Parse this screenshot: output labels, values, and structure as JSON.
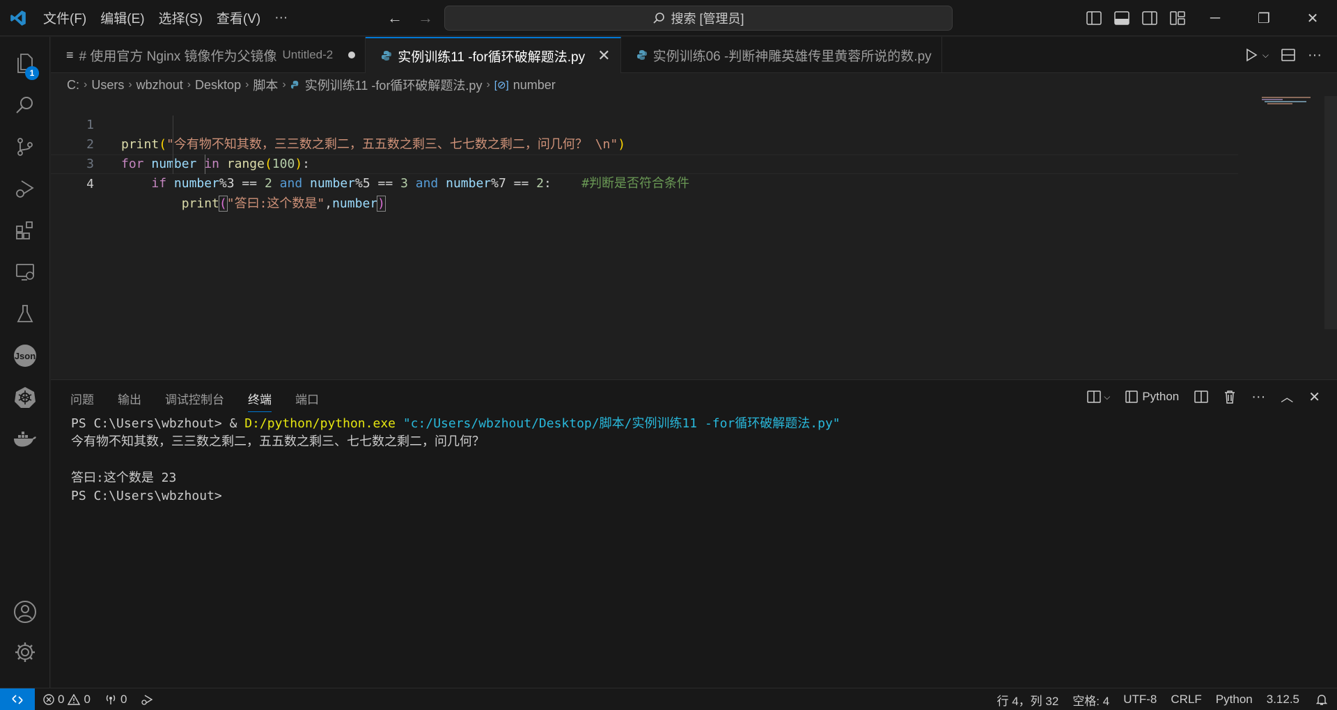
{
  "menu": {
    "file": "文件(F)",
    "edit": "编辑(E)",
    "selection": "选择(S)",
    "view": "查看(V)",
    "more": "···"
  },
  "search": {
    "label": "搜索 [管理员]"
  },
  "activity": {
    "badge_count": "1",
    "json_label": "Json"
  },
  "tabs": [
    {
      "label": "# 使用官方 Nginx 镜像作为父镜像",
      "hint": "Untitled-2"
    },
    {
      "label": "实例训练11 -for循环破解题法.py"
    },
    {
      "label": "实例训练06 -判断神雕英雄传里黄蓉所说的数.py"
    }
  ],
  "breadcrumb": {
    "drive": "C:",
    "users": "Users",
    "user": "wbzhout",
    "desktop": "Desktop",
    "folder": "脚本",
    "file": "实例训练11 -for循环破解题法.py",
    "symbol": "number"
  },
  "code": {
    "line_numbers": [
      "1",
      "2",
      "3",
      "4"
    ],
    "l1": {
      "fn": "print",
      "open": "(",
      "str": "\"今有物不知其数，三三数之剩二，五五数之剩三、七七数之剩二，问几何？ \\n\"",
      "close": ")"
    },
    "l2": {
      "for": "for",
      "var": "number",
      "in": "in",
      "fn": "range",
      "open": "(",
      "num": "100",
      "close": ")",
      "colon": ":"
    },
    "l3": {
      "if": "if",
      "v1": "number",
      "m1": "%3 == ",
      "n1": "2",
      "and1": "and",
      "v2": "number",
      "m2": "%5 == ",
      "n2": "3",
      "and2": "and",
      "v3": "number",
      "m3": "%7 == ",
      "n3": "2",
      "colon": ":",
      "comment": "#判断是否符合条件"
    },
    "l4": {
      "fn": "print",
      "open": "(",
      "str": "\"答曰:这个数是\"",
      "comma": ",",
      "var": "number",
      "close": ")"
    }
  },
  "panel": {
    "tabs": [
      "问题",
      "输出",
      "调试控制台",
      "终端",
      "端口"
    ],
    "active_tab": "终端",
    "shell_label": "Python"
  },
  "terminal": {
    "prompt1": "PS C:\\Users\\wbzhout> & ",
    "exe": "D:/python/python.exe",
    "path": "\"c:/Users/wbzhout/Desktop/脚本/实例训练11 -for循环破解题法.py\"",
    "out1": "今有物不知其数，三三数之剩二，五五数之剩三、七七数之剩二，问几何？",
    "out2": "答曰:这个数是 23",
    "prompt2": "PS C:\\Users\\wbzhout>"
  },
  "status": {
    "errors": "0",
    "warnings": "0",
    "ports": "0",
    "position": "行 4，列 32",
    "indent": "空格: 4",
    "encoding": "UTF-8",
    "eol": "CRLF",
    "language": "Python",
    "version": "3.12.5"
  },
  "colors": {
    "accent": "#0078d4",
    "editor_bg": "#1f1f1f",
    "chrome_bg": "#181818"
  }
}
